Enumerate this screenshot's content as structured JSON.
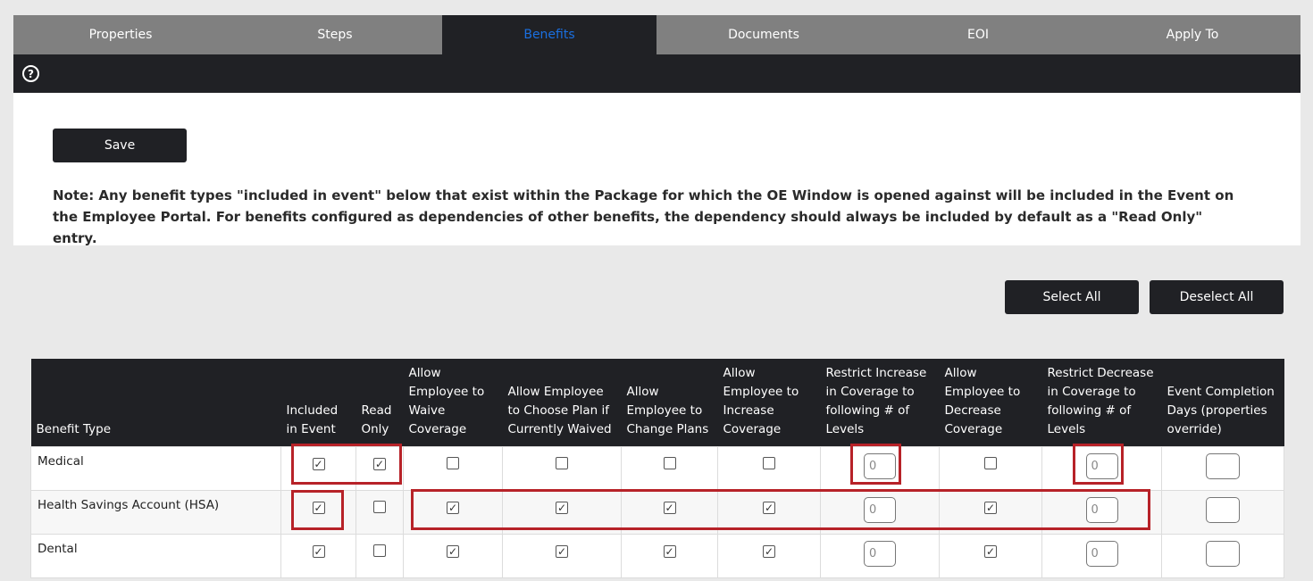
{
  "tabs": [
    {
      "label": "Properties",
      "active": false
    },
    {
      "label": "Steps",
      "active": false
    },
    {
      "label": "Benefits",
      "active": true
    },
    {
      "label": "Documents",
      "active": false
    },
    {
      "label": "EOI",
      "active": false
    },
    {
      "label": "Apply To",
      "active": false
    }
  ],
  "help_icon": "question-circle-icon",
  "save_label": "Save",
  "note": "Note: Any benefit types \"included in event\" below that exist within the Package for which the OE Window is opened against will be included in the Event on the Employee Portal. For benefits configured as dependencies of other benefits, the dependency should always be included by default as a \"Read Only\" entry.",
  "select_all_label": "Select All",
  "deselect_all_label": "Deselect All",
  "table": {
    "headers": [
      "Benefit Type",
      "Included in Event",
      "Read Only",
      "Allow Employee to Waive Coverage",
      "Allow Employee to Choose Plan if Currently Waived",
      "Allow Employee to Change Plans",
      "Allow Employee to Increase Coverage",
      "Restrict Increase in Coverage to following # of Levels",
      "Allow Employee to Decrease Coverage",
      "Restrict Decrease in Coverage to following # of Levels",
      "Event Completion Days (properties override)"
    ],
    "rows": [
      {
        "name": "Medical",
        "included": true,
        "read_only": true,
        "waive": false,
        "choose_if_waived": false,
        "change_plans": false,
        "increase": false,
        "restrict_increase": "0",
        "decrease": false,
        "restrict_decrease": "0",
        "completion_days": ""
      },
      {
        "name": "Health Savings Account (HSA)",
        "included": true,
        "read_only": false,
        "waive": true,
        "choose_if_waived": true,
        "change_plans": true,
        "increase": true,
        "restrict_increase": "0",
        "decrease": true,
        "restrict_decrease": "0",
        "completion_days": ""
      },
      {
        "name": "Dental",
        "included": true,
        "read_only": false,
        "waive": true,
        "choose_if_waived": true,
        "change_plans": true,
        "increase": true,
        "restrict_increase": "0",
        "decrease": true,
        "restrict_decrease": "0",
        "completion_days": ""
      }
    ]
  },
  "colors": {
    "dark": "#202125",
    "tab_gray": "#808080",
    "active_tab_text": "#1a6fe0",
    "highlight": "#b72228"
  }
}
